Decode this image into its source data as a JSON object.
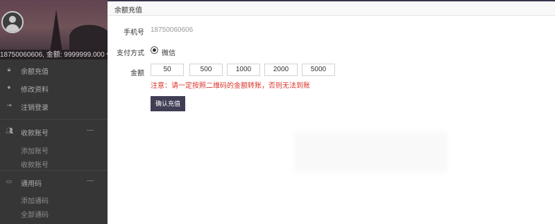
{
  "sidebar": {
    "user_line": "18750060606, 金额: 9999999.000 ▾",
    "items": [
      {
        "label": "余额充值",
        "icon": "lock-icon"
      },
      {
        "label": "修改资料",
        "icon": "user-icon"
      },
      {
        "label": "注销登录",
        "icon": "logout-icon"
      },
      {
        "label": "收款账号",
        "icon": "users-icon"
      },
      {
        "label": "通用码",
        "icon": "card-icon"
      }
    ],
    "subitems_1": [
      "添加账号",
      "收款账号"
    ],
    "subitems_2": [
      "添加通码",
      "全部通码"
    ]
  },
  "panel": {
    "title": "余额充值",
    "phone_label": "手机号",
    "phone_value": "18750060606",
    "pay_method_label": "支付方式",
    "pay_method_option": "微信",
    "amount_label": "金额",
    "amounts": [
      "50",
      "500",
      "1000",
      "2000",
      "5000"
    ],
    "notice": "注意：请一定按照二维码的金额转账，否则无法到账",
    "confirm_label": "确认充值"
  },
  "colors": {
    "accent": "#3f3e55",
    "notice": "#d9342b",
    "sidebar_bg": "#3b3b3b"
  }
}
